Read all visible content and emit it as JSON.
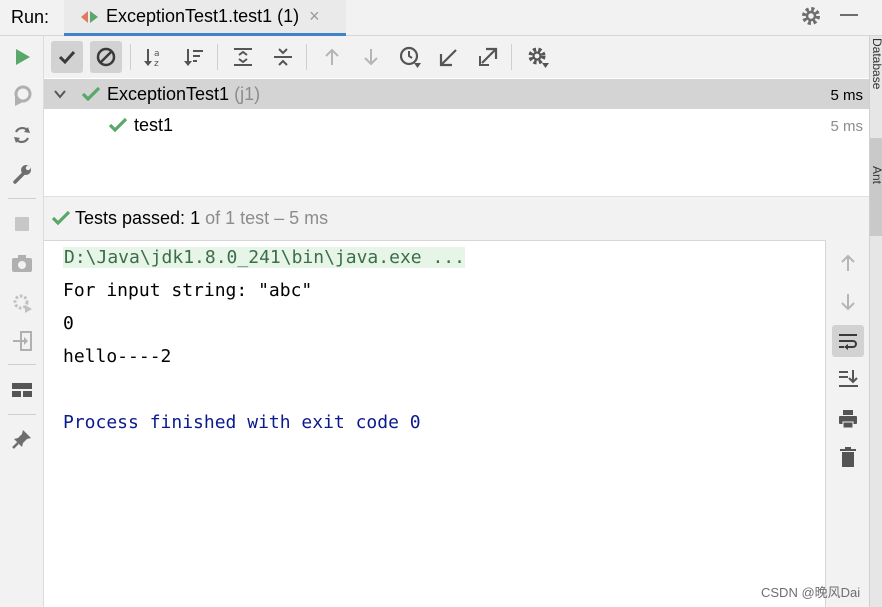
{
  "header": {
    "run_label": "Run:",
    "tab_title": "ExceptionTest1.test1 (1)",
    "tab_close": "×"
  },
  "right_strip": {
    "top_label": "Database",
    "mid_label": "Ant"
  },
  "test_tree": {
    "suite": {
      "name": "ExceptionTest1",
      "meta": "(j1)",
      "time": "5 ms"
    },
    "test": {
      "name": "test1",
      "time": "5 ms"
    }
  },
  "status": {
    "prefix": "Tests passed: ",
    "passed": "1",
    "suffix": " of 1 test – 5 ms"
  },
  "console": {
    "command": "D:\\Java\\jdk1.8.0_241\\bin\\java.exe ...",
    "lines": [
      "For input string: \"abc\"",
      "0",
      "hello----2"
    ],
    "exit_line": "Process finished with exit code 0"
  },
  "watermark": "CSDN @晚风Dai",
  "colors": {
    "pass_green": "#59a869",
    "selection_bg": "#d4d4d4",
    "tab_underline": "#4083c9",
    "exit_text": "#0b1a8c"
  }
}
